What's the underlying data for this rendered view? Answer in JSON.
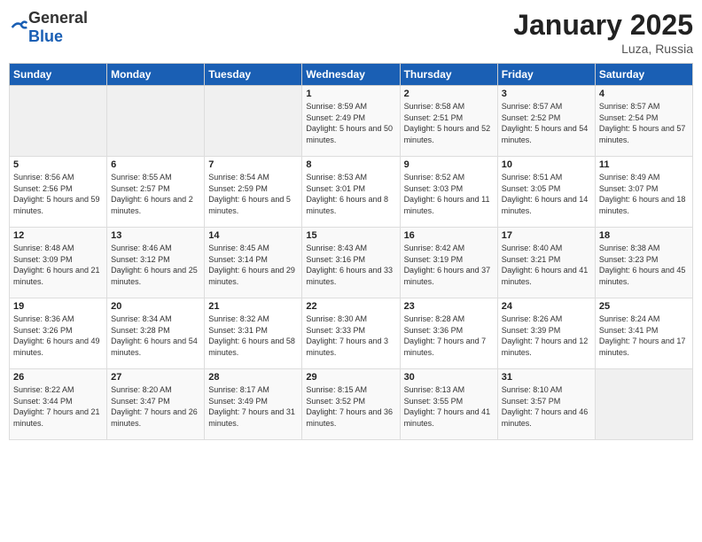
{
  "logo": {
    "general": "General",
    "blue": "Blue"
  },
  "title": "January 2025",
  "location": "Luza, Russia",
  "days_of_week": [
    "Sunday",
    "Monday",
    "Tuesday",
    "Wednesday",
    "Thursday",
    "Friday",
    "Saturday"
  ],
  "weeks": [
    [
      {
        "day": "",
        "sunrise": "",
        "sunset": "",
        "daylight": ""
      },
      {
        "day": "",
        "sunrise": "",
        "sunset": "",
        "daylight": ""
      },
      {
        "day": "",
        "sunrise": "",
        "sunset": "",
        "daylight": ""
      },
      {
        "day": "1",
        "sunrise": "Sunrise: 8:59 AM",
        "sunset": "Sunset: 2:49 PM",
        "daylight": "Daylight: 5 hours and 50 minutes."
      },
      {
        "day": "2",
        "sunrise": "Sunrise: 8:58 AM",
        "sunset": "Sunset: 2:51 PM",
        "daylight": "Daylight: 5 hours and 52 minutes."
      },
      {
        "day": "3",
        "sunrise": "Sunrise: 8:57 AM",
        "sunset": "Sunset: 2:52 PM",
        "daylight": "Daylight: 5 hours and 54 minutes."
      },
      {
        "day": "4",
        "sunrise": "Sunrise: 8:57 AM",
        "sunset": "Sunset: 2:54 PM",
        "daylight": "Daylight: 5 hours and 57 minutes."
      }
    ],
    [
      {
        "day": "5",
        "sunrise": "Sunrise: 8:56 AM",
        "sunset": "Sunset: 2:56 PM",
        "daylight": "Daylight: 5 hours and 59 minutes."
      },
      {
        "day": "6",
        "sunrise": "Sunrise: 8:55 AM",
        "sunset": "Sunset: 2:57 PM",
        "daylight": "Daylight: 6 hours and 2 minutes."
      },
      {
        "day": "7",
        "sunrise": "Sunrise: 8:54 AM",
        "sunset": "Sunset: 2:59 PM",
        "daylight": "Daylight: 6 hours and 5 minutes."
      },
      {
        "day": "8",
        "sunrise": "Sunrise: 8:53 AM",
        "sunset": "Sunset: 3:01 PM",
        "daylight": "Daylight: 6 hours and 8 minutes."
      },
      {
        "day": "9",
        "sunrise": "Sunrise: 8:52 AM",
        "sunset": "Sunset: 3:03 PM",
        "daylight": "Daylight: 6 hours and 11 minutes."
      },
      {
        "day": "10",
        "sunrise": "Sunrise: 8:51 AM",
        "sunset": "Sunset: 3:05 PM",
        "daylight": "Daylight: 6 hours and 14 minutes."
      },
      {
        "day": "11",
        "sunrise": "Sunrise: 8:49 AM",
        "sunset": "Sunset: 3:07 PM",
        "daylight": "Daylight: 6 hours and 18 minutes."
      }
    ],
    [
      {
        "day": "12",
        "sunrise": "Sunrise: 8:48 AM",
        "sunset": "Sunset: 3:09 PM",
        "daylight": "Daylight: 6 hours and 21 minutes."
      },
      {
        "day": "13",
        "sunrise": "Sunrise: 8:46 AM",
        "sunset": "Sunset: 3:12 PM",
        "daylight": "Daylight: 6 hours and 25 minutes."
      },
      {
        "day": "14",
        "sunrise": "Sunrise: 8:45 AM",
        "sunset": "Sunset: 3:14 PM",
        "daylight": "Daylight: 6 hours and 29 minutes."
      },
      {
        "day": "15",
        "sunrise": "Sunrise: 8:43 AM",
        "sunset": "Sunset: 3:16 PM",
        "daylight": "Daylight: 6 hours and 33 minutes."
      },
      {
        "day": "16",
        "sunrise": "Sunrise: 8:42 AM",
        "sunset": "Sunset: 3:19 PM",
        "daylight": "Daylight: 6 hours and 37 minutes."
      },
      {
        "day": "17",
        "sunrise": "Sunrise: 8:40 AM",
        "sunset": "Sunset: 3:21 PM",
        "daylight": "Daylight: 6 hours and 41 minutes."
      },
      {
        "day": "18",
        "sunrise": "Sunrise: 8:38 AM",
        "sunset": "Sunset: 3:23 PM",
        "daylight": "Daylight: 6 hours and 45 minutes."
      }
    ],
    [
      {
        "day": "19",
        "sunrise": "Sunrise: 8:36 AM",
        "sunset": "Sunset: 3:26 PM",
        "daylight": "Daylight: 6 hours and 49 minutes."
      },
      {
        "day": "20",
        "sunrise": "Sunrise: 8:34 AM",
        "sunset": "Sunset: 3:28 PM",
        "daylight": "Daylight: 6 hours and 54 minutes."
      },
      {
        "day": "21",
        "sunrise": "Sunrise: 8:32 AM",
        "sunset": "Sunset: 3:31 PM",
        "daylight": "Daylight: 6 hours and 58 minutes."
      },
      {
        "day": "22",
        "sunrise": "Sunrise: 8:30 AM",
        "sunset": "Sunset: 3:33 PM",
        "daylight": "Daylight: 7 hours and 3 minutes."
      },
      {
        "day": "23",
        "sunrise": "Sunrise: 8:28 AM",
        "sunset": "Sunset: 3:36 PM",
        "daylight": "Daylight: 7 hours and 7 minutes."
      },
      {
        "day": "24",
        "sunrise": "Sunrise: 8:26 AM",
        "sunset": "Sunset: 3:39 PM",
        "daylight": "Daylight: 7 hours and 12 minutes."
      },
      {
        "day": "25",
        "sunrise": "Sunrise: 8:24 AM",
        "sunset": "Sunset: 3:41 PM",
        "daylight": "Daylight: 7 hours and 17 minutes."
      }
    ],
    [
      {
        "day": "26",
        "sunrise": "Sunrise: 8:22 AM",
        "sunset": "Sunset: 3:44 PM",
        "daylight": "Daylight: 7 hours and 21 minutes."
      },
      {
        "day": "27",
        "sunrise": "Sunrise: 8:20 AM",
        "sunset": "Sunset: 3:47 PM",
        "daylight": "Daylight: 7 hours and 26 minutes."
      },
      {
        "day": "28",
        "sunrise": "Sunrise: 8:17 AM",
        "sunset": "Sunset: 3:49 PM",
        "daylight": "Daylight: 7 hours and 31 minutes."
      },
      {
        "day": "29",
        "sunrise": "Sunrise: 8:15 AM",
        "sunset": "Sunset: 3:52 PM",
        "daylight": "Daylight: 7 hours and 36 minutes."
      },
      {
        "day": "30",
        "sunrise": "Sunrise: 8:13 AM",
        "sunset": "Sunset: 3:55 PM",
        "daylight": "Daylight: 7 hours and 41 minutes."
      },
      {
        "day": "31",
        "sunrise": "Sunrise: 8:10 AM",
        "sunset": "Sunset: 3:57 PM",
        "daylight": "Daylight: 7 hours and 46 minutes."
      },
      {
        "day": "",
        "sunrise": "",
        "sunset": "",
        "daylight": ""
      }
    ]
  ]
}
